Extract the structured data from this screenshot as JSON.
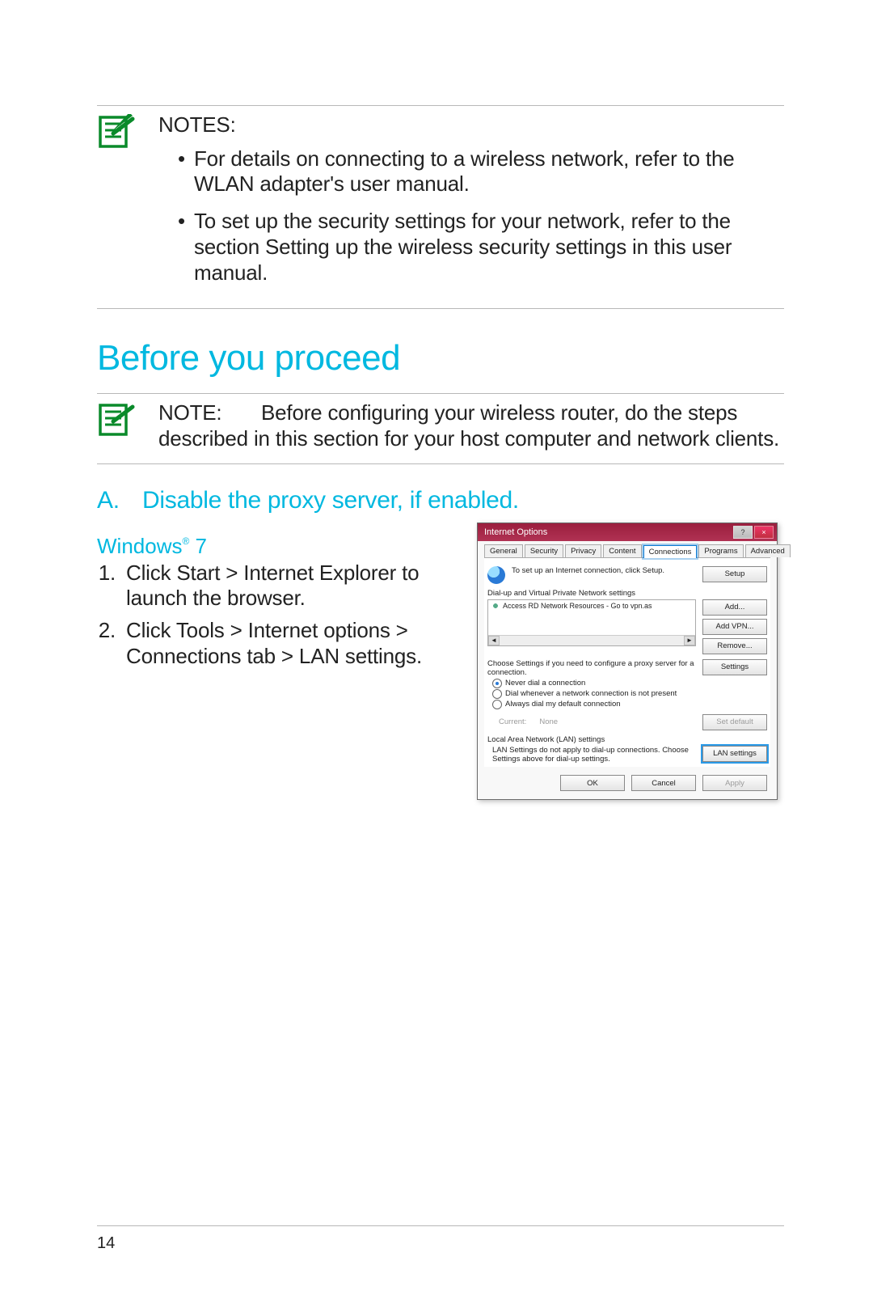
{
  "notes_block": {
    "label": "NOTES:",
    "bullets": [
      "For details on connecting to a wireless network, refer to the WLAN adapter's user manual.",
      "To set up the security settings for your network, refer to the section Setting up the wireless security settings in this user manual."
    ]
  },
  "section_title": "Before you proceed",
  "note_block2": {
    "label": "NOTE:",
    "text": "Before configuring your wireless router, do the steps described in this section for your host computer and network clients."
  },
  "subheading": {
    "letter": "A.",
    "text": "Disable the proxy server, if enabled."
  },
  "os_heading": {
    "name": "Windows",
    "reg": "®",
    "ver": " 7"
  },
  "steps": [
    "Click Start > Internet Explorer to launch the browser.",
    "Click Tools > Internet options > Connections tab > LAN settings."
  ],
  "dialog": {
    "title": "Internet Options",
    "help_btn": "?",
    "close_btn": "×",
    "tabs": [
      "General",
      "Security",
      "Privacy",
      "Content",
      "Connections",
      "Programs",
      "Advanced"
    ],
    "active_tab_index": 4,
    "setup_text": "To set up an Internet connection, click Setup.",
    "setup_btn": "Setup",
    "dialup_label": "Dial-up and Virtual Private Network settings",
    "dialup_item": "Access RD Network Resources - Go to vpn.as",
    "add_btn": "Add...",
    "add_vpn_btn": "Add VPN...",
    "remove_btn": "Remove...",
    "choose_text": "Choose Settings if you need to configure a proxy server for a connection.",
    "settings_btn": "Settings",
    "radio1": "Never dial a connection",
    "radio2": "Dial whenever a network connection is not present",
    "radio3": "Always dial my default connection",
    "current_label": "Current:",
    "current_value": "None",
    "set_default_btn": "Set default",
    "lan_label": "Local Area Network (LAN) settings",
    "lan_text": "LAN Settings do not apply to dial-up connections. Choose Settings above for dial-up settings.",
    "lan_btn": "LAN settings",
    "ok_btn": "OK",
    "cancel_btn": "Cancel",
    "apply_btn": "Apply"
  },
  "page_number": "14"
}
